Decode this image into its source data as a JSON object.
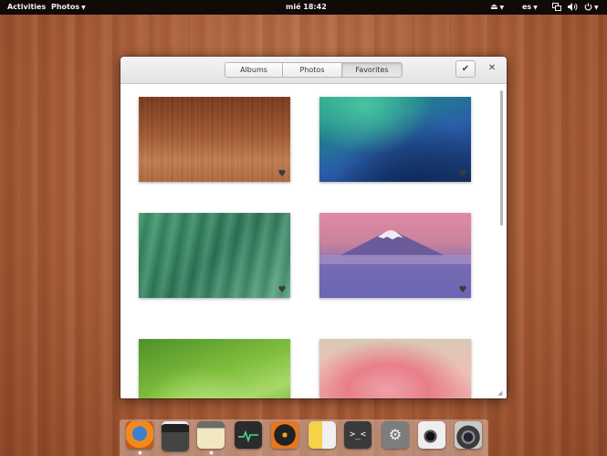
{
  "top_panel": {
    "activities": "Activities",
    "app_menu": "Photos",
    "clock": "mié 18:42",
    "keyboard_layout": "es",
    "icons": [
      "eject-icon",
      "network-icon",
      "volume-icon",
      "power-icon"
    ]
  },
  "window": {
    "tabs": [
      {
        "label": "Albums",
        "active": false
      },
      {
        "label": "Photos",
        "active": false
      },
      {
        "label": "Favorites",
        "active": true
      }
    ],
    "select_button": "✔",
    "close_button": "✕",
    "favorite_glyph": "♥",
    "photos": [
      {
        "name": "wood-wallpaper",
        "favorite": true
      },
      {
        "name": "wave-wallpaper",
        "favorite": true
      },
      {
        "name": "leaf-stripes-wallpaper",
        "favorite": true
      },
      {
        "name": "mount-fuji-wallpaper",
        "favorite": true
      },
      {
        "name": "green-leaf-wallpaper",
        "favorite": false
      },
      {
        "name": "pink-rose-wallpaper",
        "favorite": false
      }
    ]
  },
  "dock": {
    "apps": [
      "firefox-icon",
      "video-editor-icon",
      "files-icon",
      "system-monitor-icon",
      "music-player-icon",
      "audio-player-icon",
      "terminal-icon",
      "settings-icon",
      "webcam-icon",
      "camera-icon"
    ]
  },
  "colors": {
    "panel": "#120a07",
    "desktop_wood": "#a75a34"
  }
}
